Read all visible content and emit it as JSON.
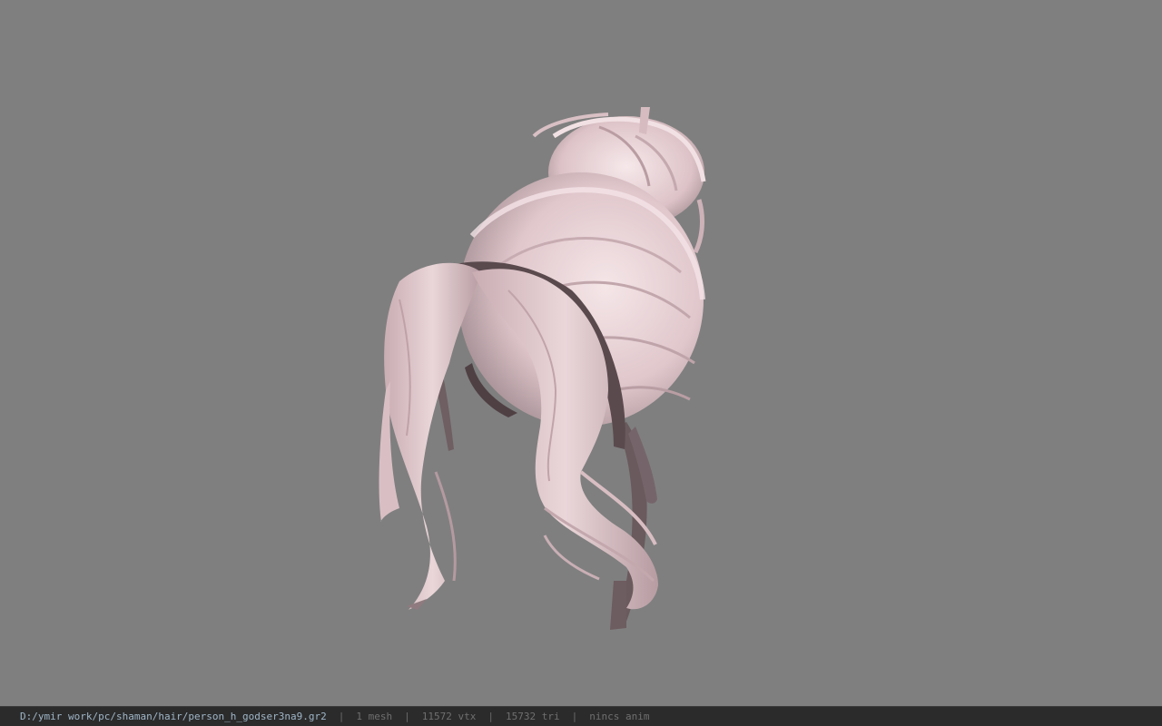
{
  "viewport": {
    "background": "#7f7f7f",
    "model": {
      "name": "hair-mesh",
      "hair_color": "#e7cfd3",
      "shadow_color": "#6b5a5d"
    }
  },
  "status": {
    "path": "D:/ymir work/pc/shaman/hair/person_h_godser3na9.gr2",
    "separator": "|",
    "mesh": "1 mesh",
    "vtx": "11572 vtx",
    "tri": "15732 tri",
    "anim": "nincs anim"
  }
}
